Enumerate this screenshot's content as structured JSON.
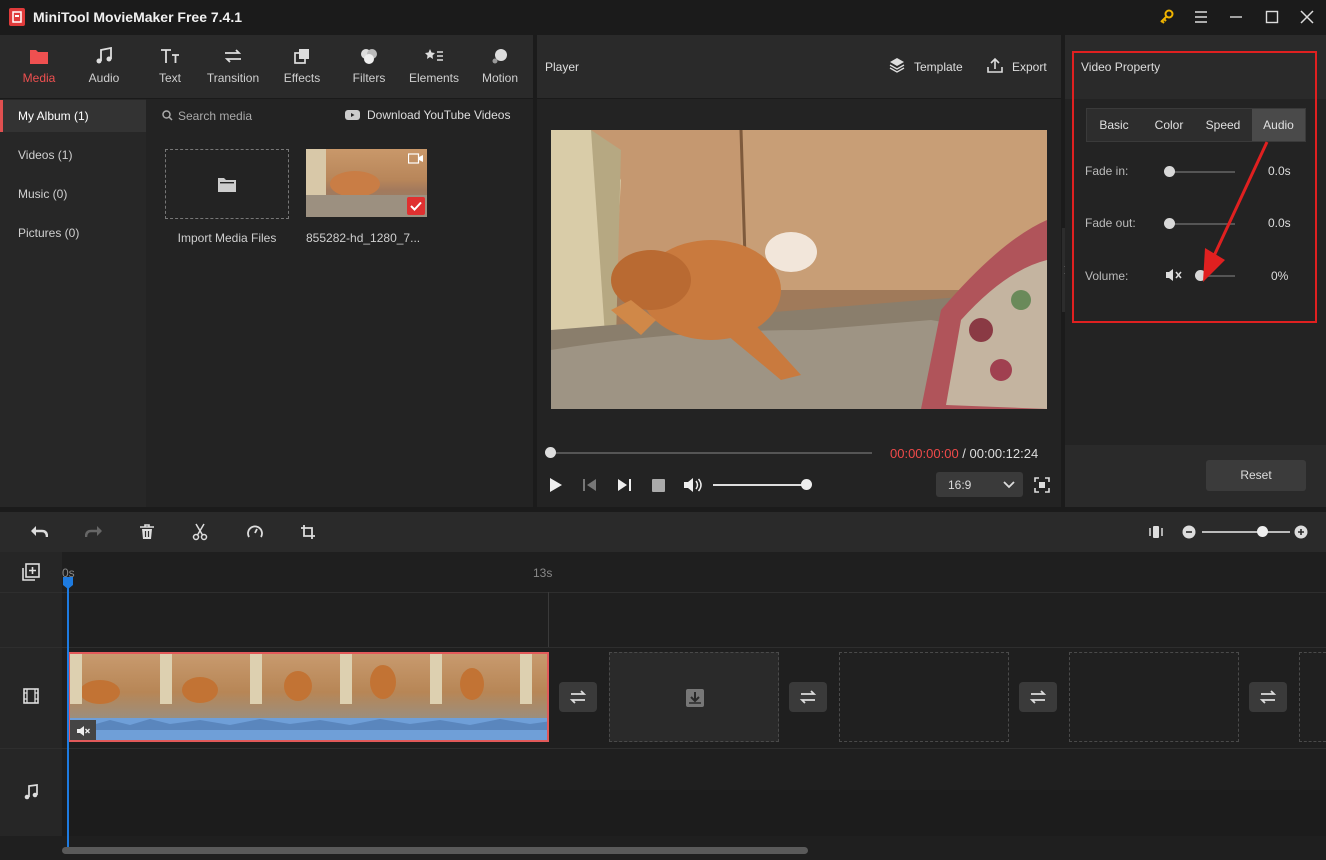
{
  "app": {
    "title": "MiniTool MovieMaker Free 7.4.1"
  },
  "toolbar": {
    "items": [
      {
        "label": "Media",
        "icon": "folder-icon"
      },
      {
        "label": "Audio",
        "icon": "music-note-icon"
      },
      {
        "label": "Text",
        "icon": "text-icon"
      },
      {
        "label": "Transition",
        "icon": "swap-icon"
      },
      {
        "label": "Effects",
        "icon": "effects-icon"
      },
      {
        "label": "Filters",
        "icon": "filters-icon"
      },
      {
        "label": "Elements",
        "icon": "elements-icon"
      },
      {
        "label": "Motion",
        "icon": "motion-icon"
      }
    ]
  },
  "album": {
    "items": [
      "My Album (1)",
      "Videos (1)",
      "Music (0)",
      "Pictures (0)"
    ]
  },
  "search": {
    "placeholder": "Search media",
    "download_label": "Download YouTube Videos"
  },
  "media": {
    "import_label": "Import Media Files",
    "clip_name": "855282-hd_1280_7..."
  },
  "player": {
    "title": "Player",
    "template_label": "Template",
    "export_label": "Export",
    "time_current": "00:00:00:00",
    "time_separator": " / ",
    "time_total": "00:00:12:24",
    "aspect_ratio": "16:9",
    "volume_level": 1.0,
    "progress": 0.0
  },
  "property": {
    "title": "Video Property",
    "tabs": [
      "Basic",
      "Color",
      "Speed",
      "Audio"
    ],
    "active_tab": "Audio",
    "fade_in_label": "Fade in:",
    "fade_in_value": "0.0s",
    "fade_out_label": "Fade out:",
    "fade_out_value": "0.0s",
    "volume_label": "Volume:",
    "volume_value": "0%",
    "reset_label": "Reset"
  },
  "timeline": {
    "ruler": [
      "0s",
      "13s"
    ],
    "zoom_level": 0.8
  },
  "colors": {
    "accent": "#ef5050",
    "highlight_border": "#e02020",
    "playhead": "#1e7be0",
    "audio_wave": "#6f9fd8"
  }
}
